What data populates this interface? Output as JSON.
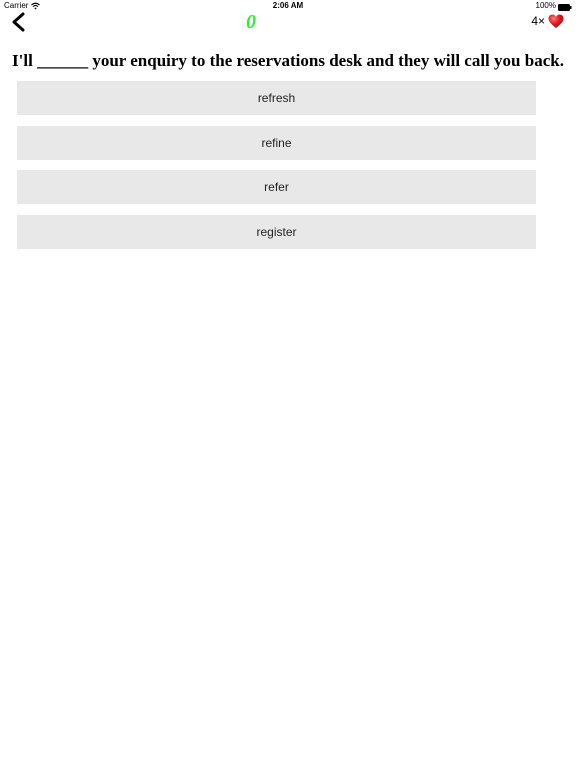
{
  "status_bar": {
    "carrier": "Carrier",
    "wifi_icon": "wifi-icon",
    "time": "2:06 AM",
    "battery_percent": "100%",
    "battery_icon": "battery-icon"
  },
  "nav": {
    "back_icon": "chevron-left-icon",
    "score": "0",
    "score_color": "#33ee33",
    "lives_count": "4×",
    "heart_icon": "heart-icon",
    "heart_color": "#e0191d"
  },
  "question": {
    "text": "I'll ______ your enquiry to the reservations desk and they will call you back."
  },
  "options": [
    {
      "label": "refresh"
    },
    {
      "label": "refine"
    },
    {
      "label": "refer"
    },
    {
      "label": "register"
    }
  ]
}
